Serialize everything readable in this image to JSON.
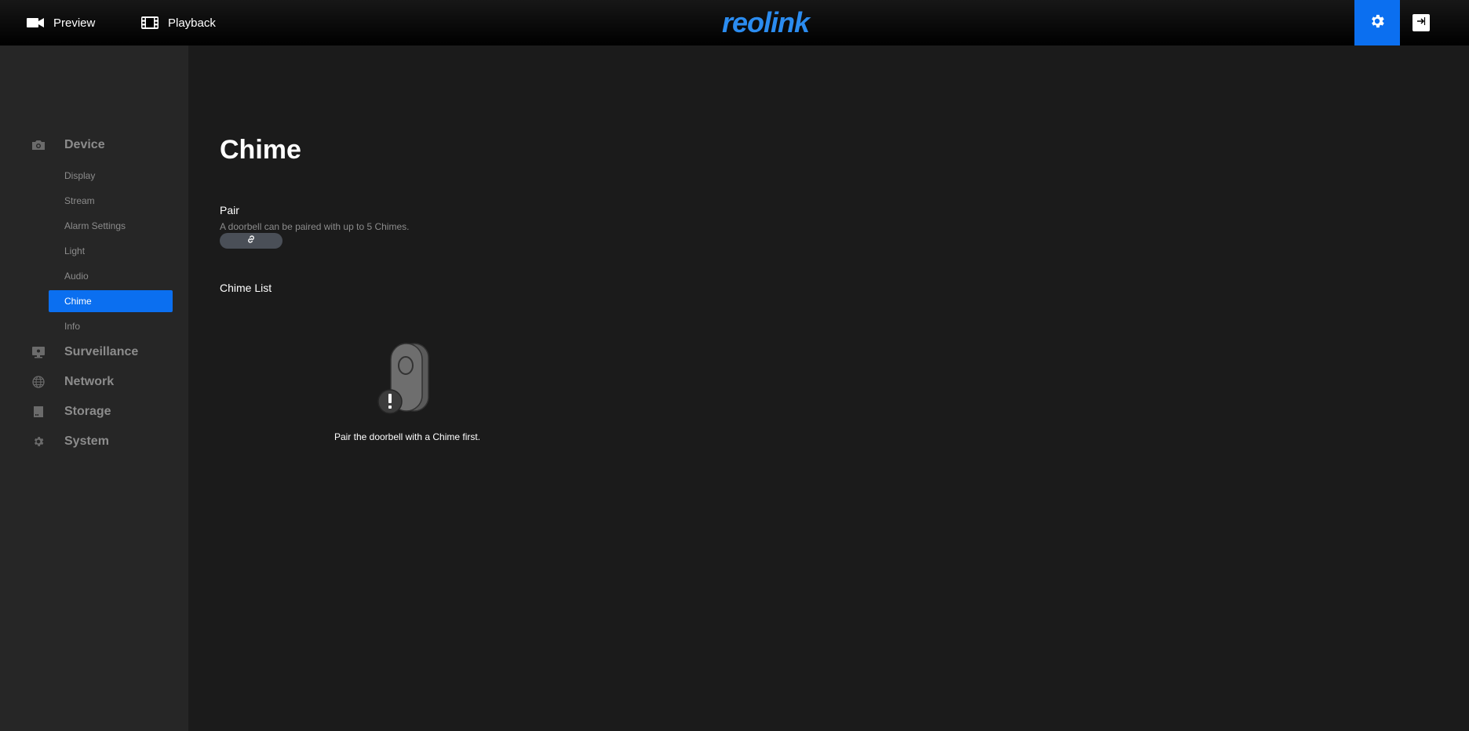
{
  "topbar": {
    "preview_label": "Preview",
    "playback_label": "Playback",
    "logo_text": "reolink",
    "logo_color": "#2b8cf0",
    "active_color": "#0b6ff0"
  },
  "sidebar": {
    "groups": [
      {
        "label": "Device",
        "icon": "camera-icon"
      },
      {
        "label": "Surveillance",
        "icon": "monitor-icon"
      },
      {
        "label": "Network",
        "icon": "globe-icon"
      },
      {
        "label": "Storage",
        "icon": "sd-card-icon"
      },
      {
        "label": "System",
        "icon": "gear-icon"
      }
    ],
    "device_items": [
      "Display",
      "Stream",
      "Alarm Settings",
      "Light",
      "Audio",
      "Chime",
      "Info"
    ],
    "active_item": "Chime"
  },
  "main": {
    "title": "Chime",
    "pair": {
      "title": "Pair",
      "description": "A doorbell can be paired with up to 5 Chimes.",
      "button_icon": "link-icon"
    },
    "chime_list": {
      "title": "Chime List",
      "empty_icon": "chime-warning-icon",
      "empty_text": "Pair the doorbell with a Chime first."
    }
  }
}
